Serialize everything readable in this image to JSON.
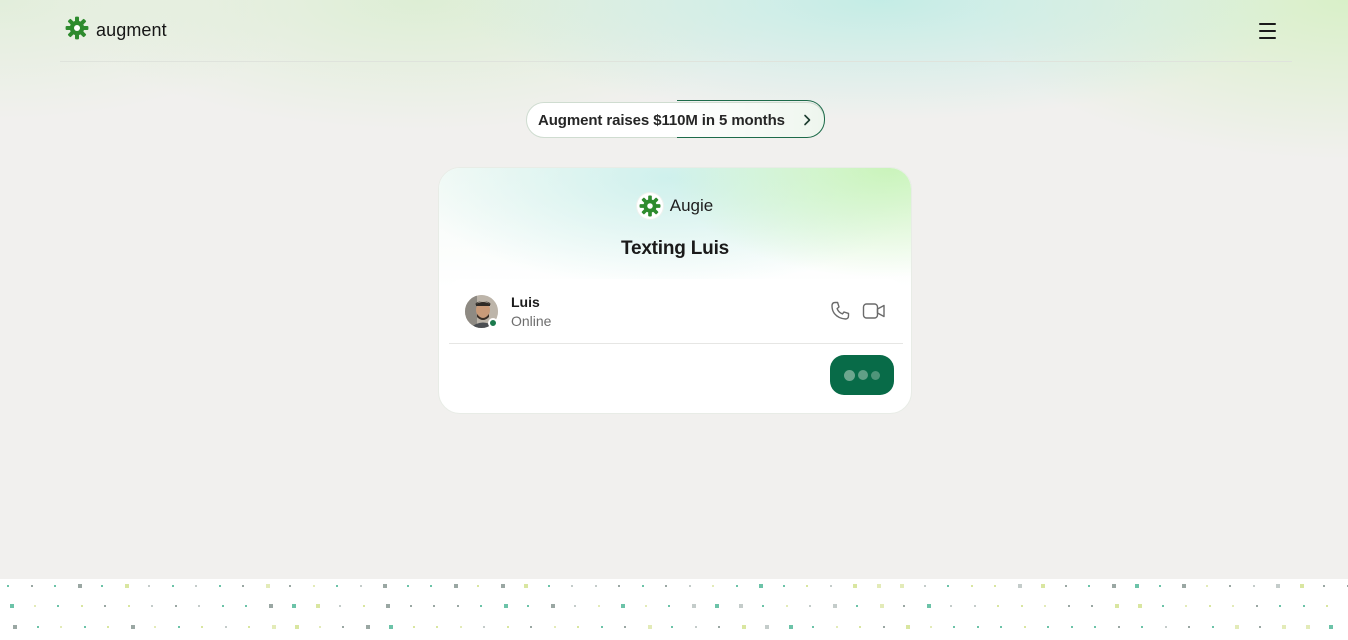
{
  "header": {
    "brand_name": "augment",
    "logo_icon": "augment-gear-icon",
    "menu_icon": "hamburger-menu-icon"
  },
  "announcement": {
    "text": "Augment raises $110M in 5 months",
    "icon": "chevron-right-icon"
  },
  "chat_card": {
    "agent_name": "Augie",
    "title": "Texting Luis",
    "contact": {
      "name": "Luis",
      "status": "Online"
    },
    "actions": [
      "phone-icon",
      "video-camera-icon"
    ],
    "typing_indicator": "typing-dots"
  },
  "colors": {
    "brand_green": "#086b48",
    "logo_green": "#2e8b2e",
    "presence_green": "#1c7a4d",
    "dot_teal": "#6cc3a8",
    "dot_yellow": "#d9e6a0",
    "dot_dark": "#9aa7a3"
  }
}
